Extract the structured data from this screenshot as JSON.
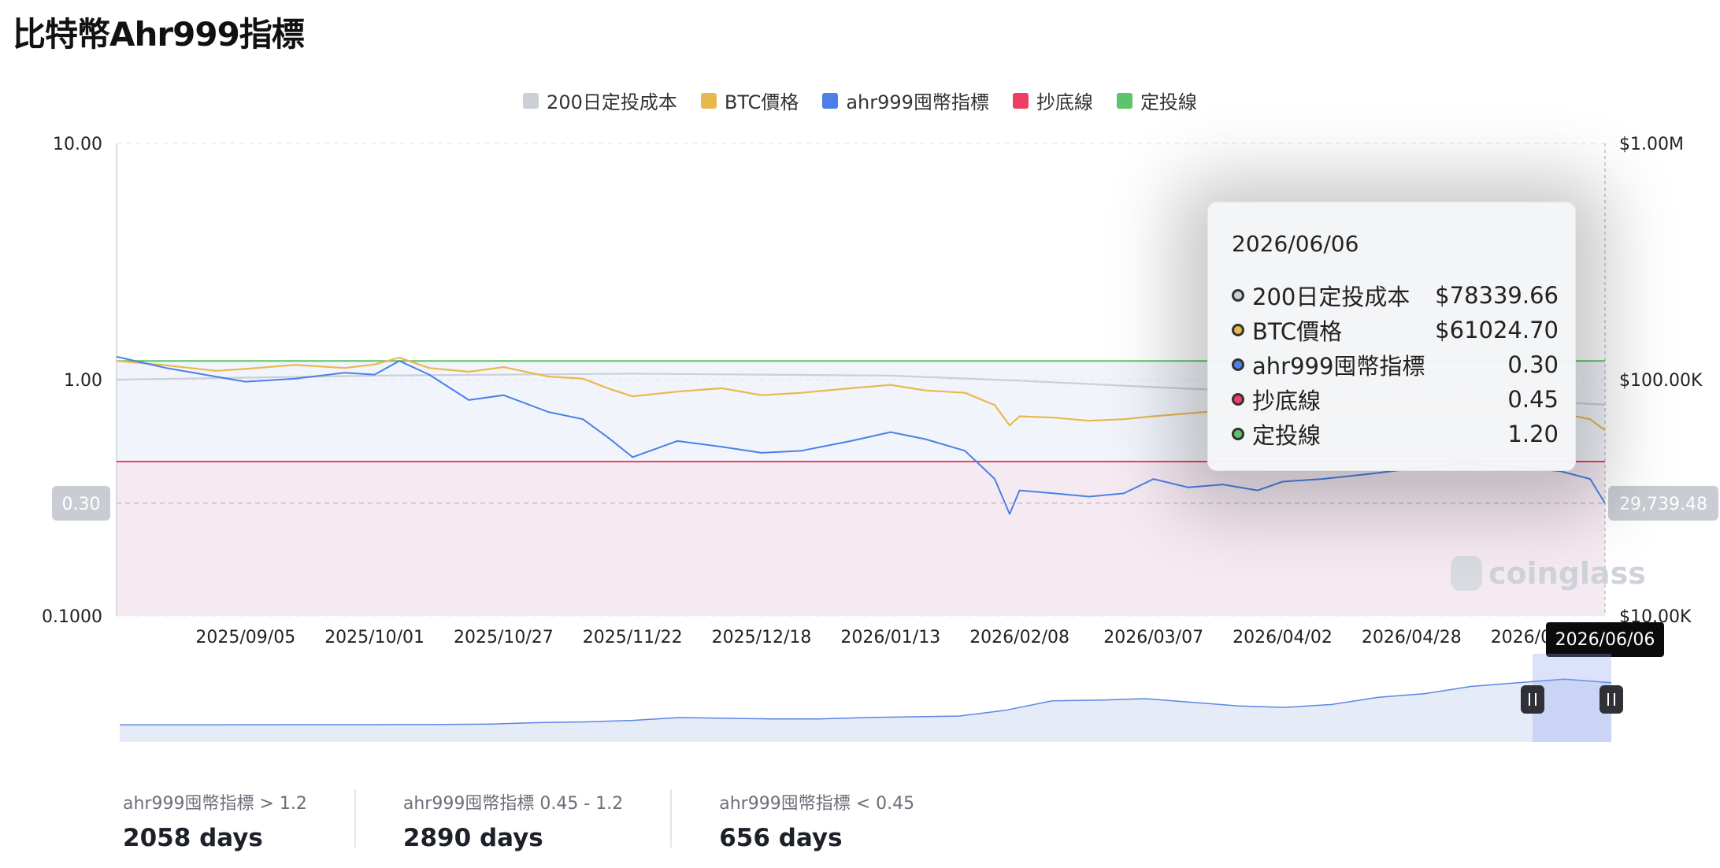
{
  "page": {
    "title": "比特幣Ahr999指標"
  },
  "legend": [
    {
      "label": "200日定投成本",
      "color": "#cbcfd6"
    },
    {
      "label": "BTC價格",
      "color": "#e7b94d"
    },
    {
      "label": "ahr999囤幣指標",
      "color": "#4a80e8"
    },
    {
      "label": "抄底線",
      "color": "#ef3e63"
    },
    {
      "label": "定投線",
      "color": "#5cc46a"
    }
  ],
  "chart_data": {
    "type": "line",
    "title": "比特幣Ahr999指標",
    "x_ticks": [
      "2025/09/05",
      "2025/10/01",
      "2025/10/27",
      "2025/11/22",
      "2025/12/18",
      "2026/01/13",
      "2026/02/08",
      "2026/03/07",
      "2026/04/02",
      "2026/04/28",
      "2026/05/24"
    ],
    "x_range": [
      "2025/08/10",
      "2026/06/06"
    ],
    "left_axis": {
      "scale": "log",
      "ylim": [
        0.1,
        10
      ],
      "ticks": [
        "10.00",
        "1.00",
        "0.1000"
      ]
    },
    "right_axis": {
      "scale": "log",
      "ylim": [
        10000,
        1000000
      ],
      "ticks": [
        "$1.00M",
        "$100.00K",
        "$10.00K"
      ]
    },
    "reference_lines": [
      {
        "name": "抄底線",
        "value": 0.45,
        "color": "#ef3e63"
      },
      {
        "name": "定投線",
        "value": 1.2,
        "color": "#5cc46a"
      }
    ],
    "series": [
      {
        "name": "ahr999囤幣指標",
        "axis": "left",
        "color": "#4a80e8",
        "points": [
          [
            "2025/08/10",
            1.25
          ],
          [
            "2025/08/20",
            1.12
          ],
          [
            "2025/08/30",
            1.03
          ],
          [
            "2025/09/05",
            0.98
          ],
          [
            "2025/09/15",
            1.01
          ],
          [
            "2025/09/25",
            1.07
          ],
          [
            "2025/10/01",
            1.05
          ],
          [
            "2025/10/06",
            1.2
          ],
          [
            "2025/10/12",
            1.05
          ],
          [
            "2025/10/20",
            0.82
          ],
          [
            "2025/10/27",
            0.86
          ],
          [
            "2025/11/05",
            0.73
          ],
          [
            "2025/11/12",
            0.68
          ],
          [
            "2025/11/17",
            0.57
          ],
          [
            "2025/11/22",
            0.47
          ],
          [
            "2025/12/01",
            0.55
          ],
          [
            "2025/12/10",
            0.52
          ],
          [
            "2025/12/18",
            0.49
          ],
          [
            "2025/12/26",
            0.5
          ],
          [
            "2026/01/05",
            0.55
          ],
          [
            "2026/01/13",
            0.6
          ],
          [
            "2026/01/20",
            0.56
          ],
          [
            "2026/01/28",
            0.5
          ],
          [
            "2026/02/03",
            0.38
          ],
          [
            "2026/02/06",
            0.27
          ],
          [
            "2026/02/08",
            0.34
          ],
          [
            "2026/02/15",
            0.33
          ],
          [
            "2026/02/22",
            0.32
          ],
          [
            "2026/03/01",
            0.33
          ],
          [
            "2026/03/07",
            0.38
          ],
          [
            "2026/03/14",
            0.35
          ],
          [
            "2026/03/21",
            0.36
          ],
          [
            "2026/03/28",
            0.34
          ],
          [
            "2026/04/02",
            0.37
          ],
          [
            "2026/04/10",
            0.38
          ],
          [
            "2026/04/20",
            0.4
          ],
          [
            "2026/04/28",
            0.42
          ],
          [
            "2026/05/08",
            0.44
          ],
          [
            "2026/05/18",
            0.43
          ],
          [
            "2026/05/28",
            0.41
          ],
          [
            "2026/06/03",
            0.38
          ],
          [
            "2026/06/06",
            0.3
          ]
        ]
      },
      {
        "name": "BTC價格",
        "axis": "right",
        "color": "#e7b94d",
        "points": [
          [
            "2025/08/10",
            120000
          ],
          [
            "2025/08/20",
            115000
          ],
          [
            "2025/08/30",
            109000
          ],
          [
            "2025/09/05",
            111000
          ],
          [
            "2025/09/15",
            115500
          ],
          [
            "2025/09/25",
            112000
          ],
          [
            "2025/10/01",
            116000
          ],
          [
            "2025/10/06",
            124000
          ],
          [
            "2025/10/12",
            112000
          ],
          [
            "2025/10/20",
            108000
          ],
          [
            "2025/10/27",
            113000
          ],
          [
            "2025/11/05",
            103000
          ],
          [
            "2025/11/12",
            101000
          ],
          [
            "2025/11/17",
            92000
          ],
          [
            "2025/11/22",
            85000
          ],
          [
            "2025/12/01",
            89000
          ],
          [
            "2025/12/10",
            92000
          ],
          [
            "2025/12/18",
            86000
          ],
          [
            "2025/12/26",
            88000
          ],
          [
            "2026/01/05",
            92000
          ],
          [
            "2026/01/13",
            95000
          ],
          [
            "2026/01/20",
            90000
          ],
          [
            "2026/01/28",
            88000
          ],
          [
            "2026/02/03",
            78000
          ],
          [
            "2026/02/06",
            64000
          ],
          [
            "2026/02/08",
            70000
          ],
          [
            "2026/02/15",
            69000
          ],
          [
            "2026/02/22",
            67000
          ],
          [
            "2026/03/01",
            68000
          ],
          [
            "2026/03/07",
            70000
          ],
          [
            "2026/03/14",
            72000
          ],
          [
            "2026/03/21",
            74000
          ],
          [
            "2026/03/28",
            72000
          ],
          [
            "2026/04/02",
            76000
          ],
          [
            "2026/04/10",
            75000
          ],
          [
            "2026/04/20",
            76000
          ],
          [
            "2026/04/28",
            77000
          ],
          [
            "2026/05/08",
            78000
          ],
          [
            "2026/05/18",
            76000
          ],
          [
            "2026/05/28",
            72000
          ],
          [
            "2026/06/03",
            68000
          ],
          [
            "2026/06/06",
            61024.7
          ]
        ]
      },
      {
        "name": "200日定投成本",
        "axis": "right",
        "color": "#cbcfd6",
        "points": [
          [
            "2025/08/10",
            100000
          ],
          [
            "2025/10/01",
            104000
          ],
          [
            "2025/11/22",
            106000
          ],
          [
            "2026/01/13",
            104000
          ],
          [
            "2026/02/08",
            99000
          ],
          [
            "2026/03/07",
            93000
          ],
          [
            "2026/04/02",
            88000
          ],
          [
            "2026/04/28",
            84000
          ],
          [
            "2026/05/24",
            81000
          ],
          [
            "2026/06/06",
            78339.66
          ]
        ]
      }
    ],
    "current_markers": {
      "left_value": "0.30",
      "right_value": "29,739.48",
      "date": "2026/06/06"
    },
    "navigator": {
      "range_start": "2025/08/10",
      "range_end": "2026/06/06",
      "values": [
        0.02,
        0.02,
        0.02,
        0.021,
        0.022,
        0.022,
        0.023,
        0.025,
        0.03,
        0.05,
        0.06,
        0.08,
        0.12,
        0.11,
        0.1,
        0.1,
        0.12,
        0.13,
        0.14,
        0.22,
        0.35,
        0.36,
        0.38,
        0.33,
        0.28,
        0.26,
        0.3,
        0.4,
        0.45,
        0.55,
        0.6,
        0.65,
        0.6
      ]
    }
  },
  "tooltip": {
    "date": "2026/06/06",
    "rows": [
      {
        "label": "200日定投成本",
        "value": "$78339.66",
        "color": "#cbcfd6"
      },
      {
        "label": "BTC價格",
        "value": "$61024.70",
        "color": "#e7b94d"
      },
      {
        "label": "ahr999囤幣指標",
        "value": "0.30",
        "color": "#4a80e8"
      },
      {
        "label": "抄底線",
        "value": "0.45",
        "color": "#ef3e63"
      },
      {
        "label": "定投線",
        "value": "1.20",
        "color": "#5cc46a"
      }
    ]
  },
  "watermark": {
    "text": "coinglass"
  },
  "stats": [
    {
      "label": "ahr999囤幣指標 > 1.2",
      "value": "2058 days"
    },
    {
      "label": "ahr999囤幣指標 0.45 - 1.2",
      "value": "2890 days"
    },
    {
      "label": "ahr999囤幣指標 < 0.45",
      "value": "656 days"
    }
  ]
}
